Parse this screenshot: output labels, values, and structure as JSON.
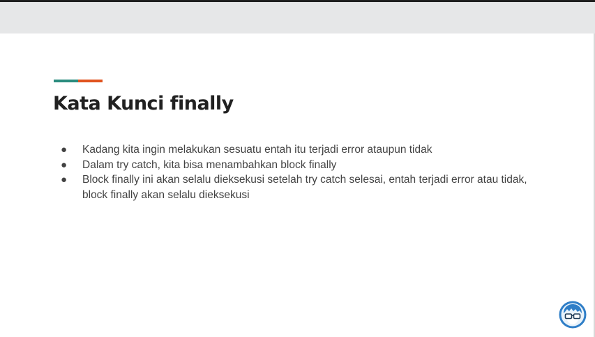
{
  "slide": {
    "title": "Kata Kunci finally",
    "bullets": [
      "Kadang kita ingin melakukan sesuatu entah itu terjadi error ataupun tidak",
      "Dalam try catch, kita bisa menambahkan block finally",
      "Block finally ini akan selalu dieksekusi setelah try catch selesai, entah terjadi error atau tidak, block finally akan selalu dieksekusi"
    ],
    "bullet_glyph": "●"
  },
  "colors": {
    "accent_teal": "#2a8c7e",
    "accent_orange": "#e0531f",
    "avatar_ring": "#2f7ec7"
  },
  "logo": {
    "icon": "avatar-with-glasses-icon"
  }
}
